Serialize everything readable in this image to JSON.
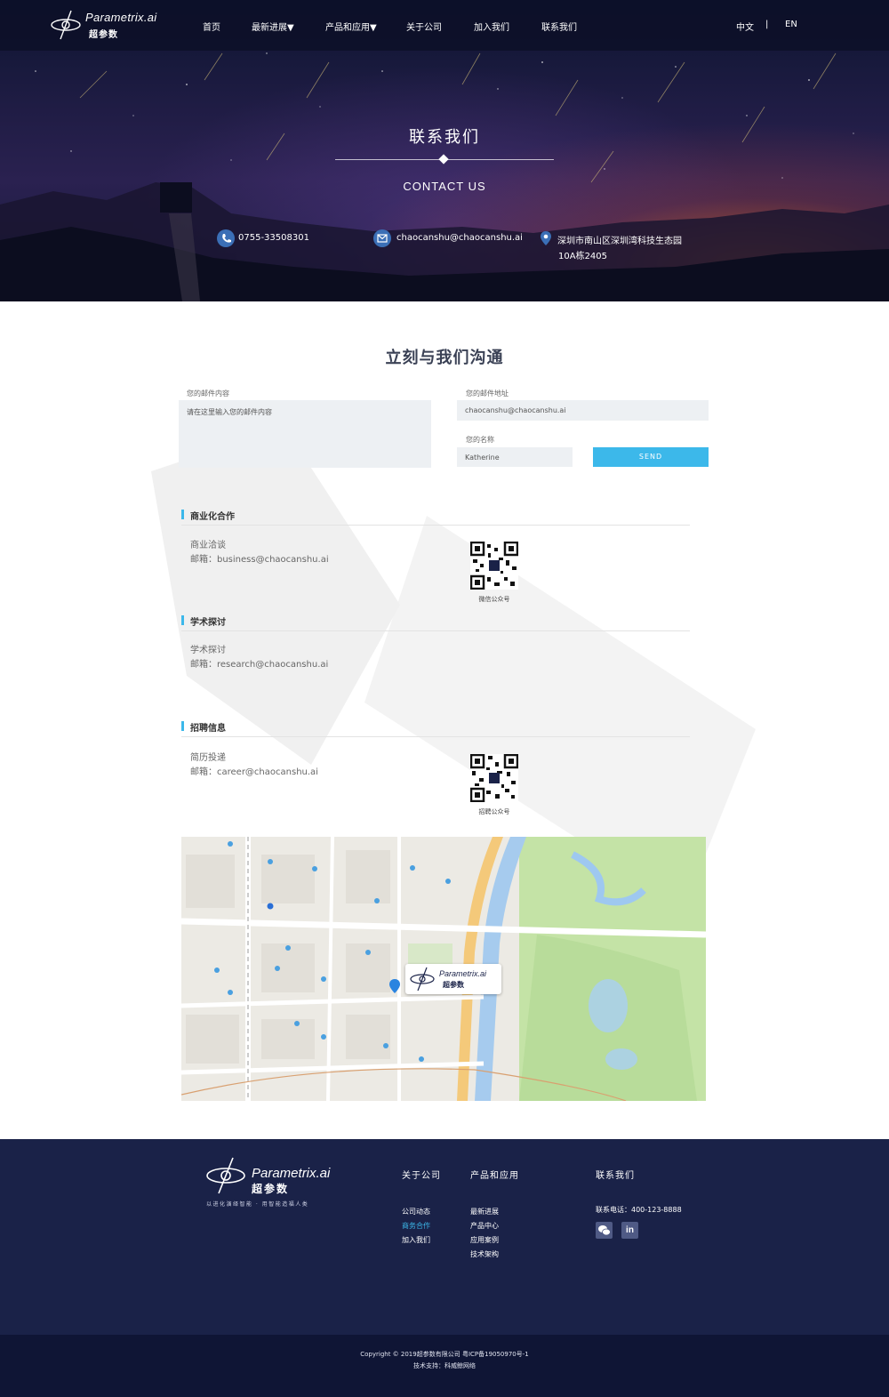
{
  "brand": {
    "name_en": "Parametrix.ai",
    "name_cn": "超参数"
  },
  "nav": {
    "items": [
      {
        "label": "首页"
      },
      {
        "label": "最新进展▼"
      },
      {
        "label": "产品和应用▼"
      },
      {
        "label": "关于公司"
      },
      {
        "label": "加入我们"
      },
      {
        "label": "联系我们"
      }
    ],
    "lang_cn": "中文",
    "lang_sep": "|",
    "lang_en": "EN"
  },
  "hero": {
    "title": "联系我们",
    "subtitle": "CONTACT US",
    "phone": "0755-33508301",
    "email": "chaocanshu@chaocanshu.ai",
    "address_line1": "深圳市南山区深圳湾科技生态园",
    "address_line2": "10A栋2405"
  },
  "form": {
    "title": "立刻与我们沟通",
    "content_label": "您的邮件内容",
    "content_placeholder": "请在这里输入您的邮件内容",
    "email_label": "您的邮件地址",
    "email_value": "chaocanshu@chaocanshu.ai",
    "name_label": "您的名称",
    "name_value": "Katherine",
    "send_label": "SEND"
  },
  "sections": {
    "business": {
      "title": "商业化合作",
      "line1": "商业洽谈",
      "line2": "邮箱：business@chaocanshu.ai",
      "qr_caption": "微信公众号"
    },
    "academic": {
      "title": "学术探讨",
      "line1": "学术探讨",
      "line2": "邮箱：research@chaocanshu.ai"
    },
    "recruit": {
      "title": "招聘信息",
      "line1": "简历投递",
      "line2": "邮箱：career@chaocanshu.ai",
      "qr_caption": "招聘公众号"
    }
  },
  "map": {
    "card_brand_en": "Parametrix.ai",
    "card_brand_cn": "超参数"
  },
  "footer": {
    "slogan": "以进化演绎智能 · 用智能造福人类",
    "col1_title": "关于公司",
    "col1_links": [
      "公司动态",
      "商务合作",
      "加入我们"
    ],
    "col2_title": "产品和应用",
    "col2_links": [
      "最新进展",
      "产品中心",
      "应用案例",
      "技术架构"
    ],
    "col3_title": "联系我们",
    "phone_text": "联系电话：400-123-8888",
    "active_link_color": "#3cb8ea",
    "copyright": "Copyright © 2019超参数有限公司 粤ICP备19050970号-1",
    "support": "技术支持：科威鲸网络"
  },
  "colors": {
    "accent": "#3cb8ea",
    "footer_bg": "#1a2248",
    "copyright_bg": "#0f1535"
  }
}
